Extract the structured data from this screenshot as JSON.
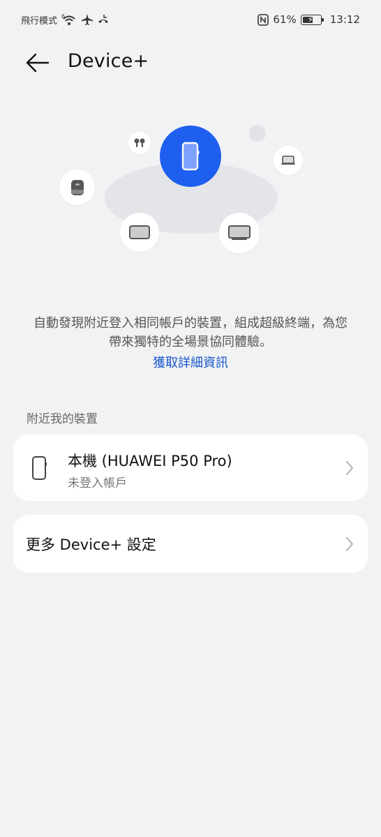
{
  "status_bar": {
    "left_text": "飛行模式",
    "signal_sup": "6",
    "battery_percent": "61%",
    "battery_level": 0.61,
    "time": "13:12"
  },
  "header": {
    "title": "Device+"
  },
  "description": {
    "text": "自動發現附近登入相同帳戶的裝置，組成超級終端，為您帶來獨特的全場景協同體驗。",
    "link": "獲取詳細資訊"
  },
  "section": {
    "label": "附近我的裝置"
  },
  "device_card": {
    "name": "本機 (HUAWEI P50 Pro)",
    "status": "未登入帳戶"
  },
  "more_card": {
    "label": "更多 Device+ 設定"
  },
  "colors": {
    "accent": "#1f5ff0",
    "link": "#1956c9",
    "background": "#f1f2f4"
  },
  "icons": [
    "back-arrow-icon",
    "phone-icon",
    "earbuds-icon",
    "speaker-icon",
    "tablet-icon",
    "laptop-icon",
    "tv-icon",
    "chevron-right-icon"
  ]
}
